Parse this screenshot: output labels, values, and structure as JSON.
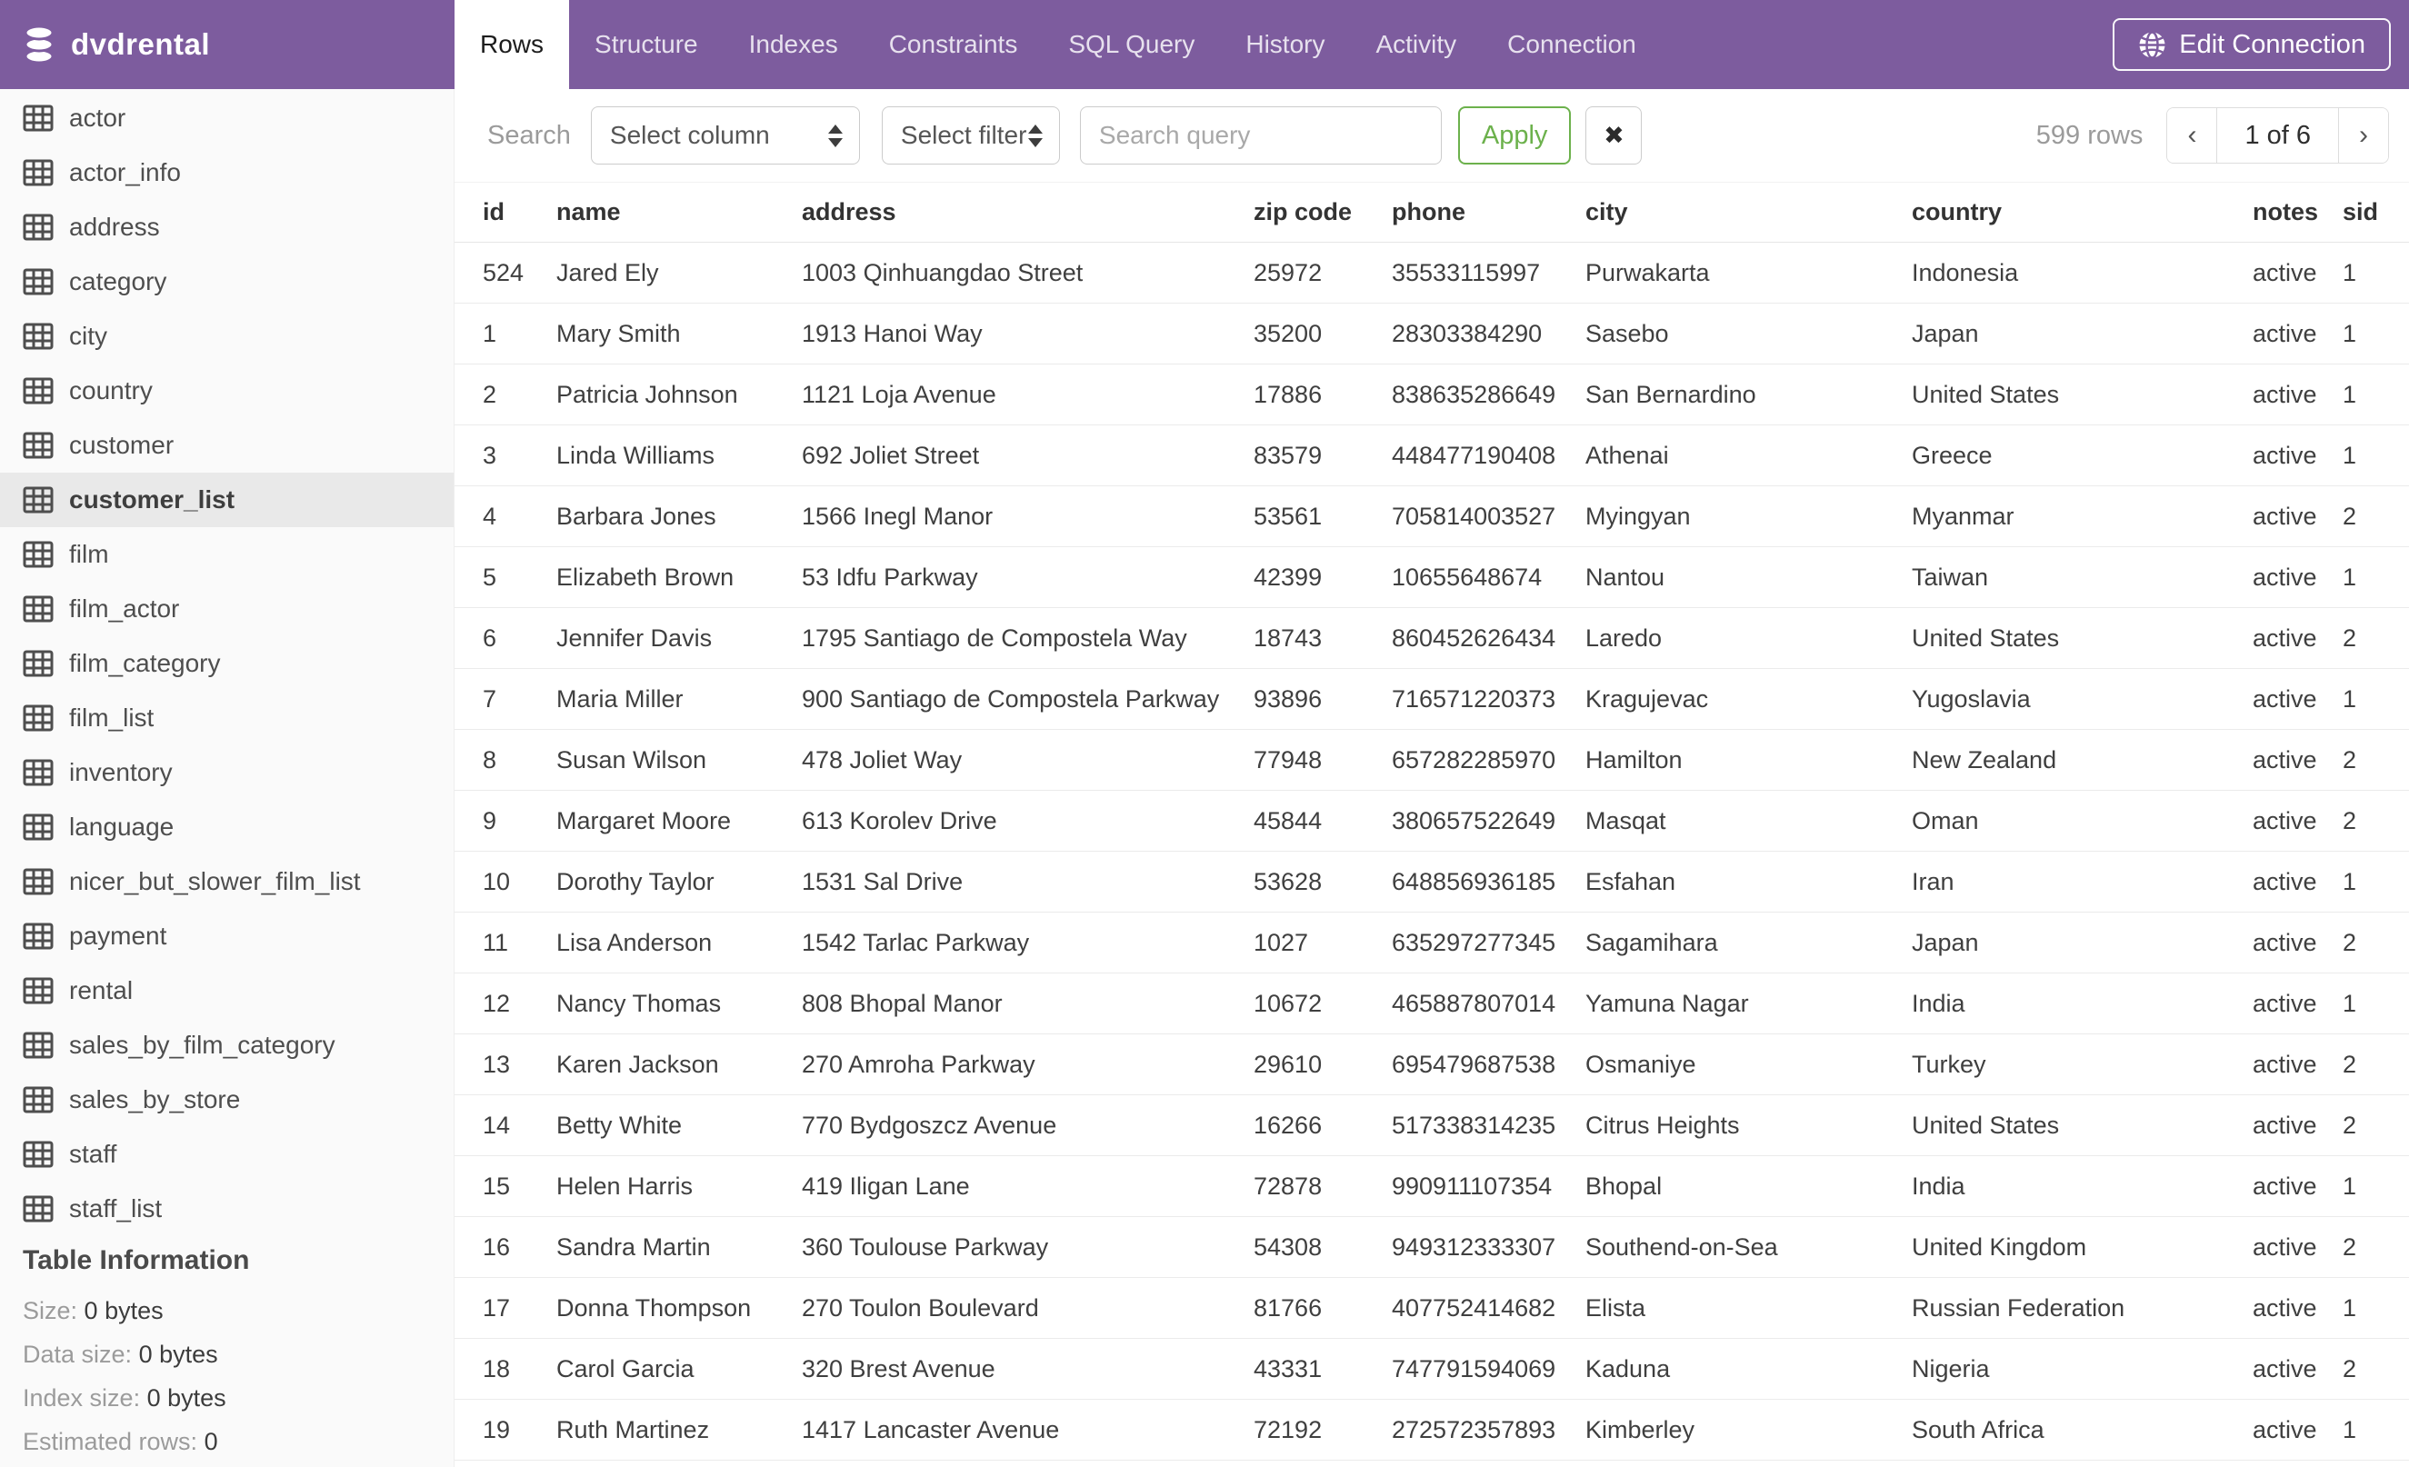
{
  "header": {
    "database": "dvdrental",
    "tabs": [
      {
        "label": "Rows",
        "active": true
      },
      {
        "label": "Structure",
        "active": false
      },
      {
        "label": "Indexes",
        "active": false
      },
      {
        "label": "Constraints",
        "active": false
      },
      {
        "label": "SQL Query",
        "active": false
      },
      {
        "label": "History",
        "active": false
      },
      {
        "label": "Activity",
        "active": false
      },
      {
        "label": "Connection",
        "active": false
      }
    ],
    "edit_connection_label": "Edit Connection"
  },
  "sidebar": {
    "tables": [
      "actor",
      "actor_info",
      "address",
      "category",
      "city",
      "country",
      "customer",
      "customer_list",
      "film",
      "film_actor",
      "film_category",
      "film_list",
      "inventory",
      "language",
      "nicer_but_slower_film_list",
      "payment",
      "rental",
      "sales_by_film_category",
      "sales_by_store",
      "staff",
      "staff_list"
    ],
    "selected_table": "customer_list",
    "table_information": {
      "title": "Table Information",
      "rows": [
        {
          "label": "Size:",
          "value": "0 bytes"
        },
        {
          "label": "Data size:",
          "value": "0 bytes"
        },
        {
          "label": "Index size:",
          "value": "0 bytes"
        },
        {
          "label": "Estimated rows:",
          "value": "0"
        }
      ]
    }
  },
  "toolbar": {
    "search_label": "Search",
    "column_select_value": "Select column",
    "filter_select_value": "Select filter",
    "query_placeholder": "Search query",
    "query_value": "",
    "apply_label": "Apply",
    "clear_label": "✖",
    "row_count": "599 rows",
    "pagination": {
      "prev": "‹",
      "page": "1 of 6",
      "next": "›"
    }
  },
  "grid": {
    "columns": [
      "id",
      "name",
      "address",
      "zip code",
      "phone",
      "city",
      "country",
      "notes",
      "sid"
    ],
    "rows": [
      [
        "524",
        "Jared Ely",
        "1003 Qinhuangdao Street",
        "25972",
        "35533115997",
        "Purwakarta",
        "Indonesia",
        "active",
        "1"
      ],
      [
        "1",
        "Mary Smith",
        "1913 Hanoi Way",
        "35200",
        "28303384290",
        "Sasebo",
        "Japan",
        "active",
        "1"
      ],
      [
        "2",
        "Patricia Johnson",
        "1121 Loja Avenue",
        "17886",
        "838635286649",
        "San Bernardino",
        "United States",
        "active",
        "1"
      ],
      [
        "3",
        "Linda Williams",
        "692 Joliet Street",
        "83579",
        "448477190408",
        "Athenai",
        "Greece",
        "active",
        "1"
      ],
      [
        "4",
        "Barbara Jones",
        "1566 Inegl Manor",
        "53561",
        "705814003527",
        "Myingyan",
        "Myanmar",
        "active",
        "2"
      ],
      [
        "5",
        "Elizabeth Brown",
        "53 Idfu Parkway",
        "42399",
        "10655648674",
        "Nantou",
        "Taiwan",
        "active",
        "1"
      ],
      [
        "6",
        "Jennifer Davis",
        "1795 Santiago de Compostela Way",
        "18743",
        "860452626434",
        "Laredo",
        "United States",
        "active",
        "2"
      ],
      [
        "7",
        "Maria Miller",
        "900 Santiago de Compostela Parkway",
        "93896",
        "716571220373",
        "Kragujevac",
        "Yugoslavia",
        "active",
        "1"
      ],
      [
        "8",
        "Susan Wilson",
        "478 Joliet Way",
        "77948",
        "657282285970",
        "Hamilton",
        "New Zealand",
        "active",
        "2"
      ],
      [
        "9",
        "Margaret Moore",
        "613 Korolev Drive",
        "45844",
        "380657522649",
        "Masqat",
        "Oman",
        "active",
        "2"
      ],
      [
        "10",
        "Dorothy Taylor",
        "1531 Sal Drive",
        "53628",
        "648856936185",
        "Esfahan",
        "Iran",
        "active",
        "1"
      ],
      [
        "11",
        "Lisa Anderson",
        "1542 Tarlac Parkway",
        "1027",
        "635297277345",
        "Sagamihara",
        "Japan",
        "active",
        "2"
      ],
      [
        "12",
        "Nancy Thomas",
        "808 Bhopal Manor",
        "10672",
        "465887807014",
        "Yamuna Nagar",
        "India",
        "active",
        "1"
      ],
      [
        "13",
        "Karen Jackson",
        "270 Amroha Parkway",
        "29610",
        "695479687538",
        "Osmaniye",
        "Turkey",
        "active",
        "2"
      ],
      [
        "14",
        "Betty White",
        "770 Bydgoszcz Avenue",
        "16266",
        "517338314235",
        "Citrus Heights",
        "United States",
        "active",
        "2"
      ],
      [
        "15",
        "Helen Harris",
        "419 Iligan Lane",
        "72878",
        "990911107354",
        "Bhopal",
        "India",
        "active",
        "1"
      ],
      [
        "16",
        "Sandra Martin",
        "360 Toulouse Parkway",
        "54308",
        "949312333307",
        "Southend-on-Sea",
        "United Kingdom",
        "active",
        "2"
      ],
      [
        "17",
        "Donna Thompson",
        "270 Toulon Boulevard",
        "81766",
        "407752414682",
        "Elista",
        "Russian Federation",
        "active",
        "1"
      ],
      [
        "18",
        "Carol Garcia",
        "320 Brest Avenue",
        "43331",
        "747791594069",
        "Kaduna",
        "Nigeria",
        "active",
        "2"
      ],
      [
        "19",
        "Ruth Martinez",
        "1417 Lancaster Avenue",
        "72192",
        "272572357893",
        "Kimberley",
        "South Africa",
        "active",
        "1"
      ]
    ]
  },
  "colors": {
    "header_purple": "#7D5C9E",
    "apply_green": "#6CB14C",
    "selected_item_bg": "#E9E9E9",
    "sidebar_bg": "#FAFAFA"
  }
}
